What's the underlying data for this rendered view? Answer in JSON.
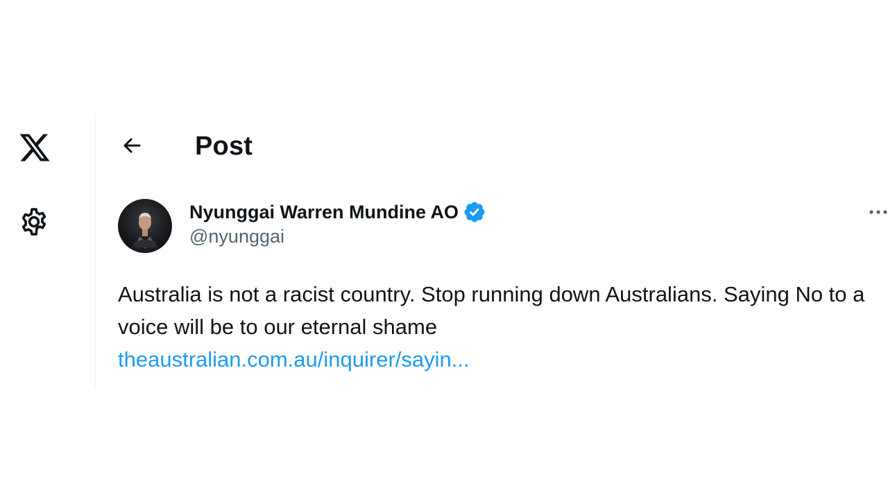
{
  "nav": {
    "logo_icon": "x-logo-icon",
    "settings_icon": "gear-icon"
  },
  "header": {
    "back_icon": "arrow-left-icon",
    "title": "Post"
  },
  "post": {
    "author": {
      "name": "Nyunggai Warren Mundine AO",
      "handle": "@nyunggai",
      "verified": true,
      "badge_icon": "verified-badge-icon",
      "badge_color": "#1d9bf0"
    },
    "more_icon": "more-options-icon",
    "text": "Australia is not a racist country. Stop running down Australians. Saying No to a voice will be to our eternal shame",
    "link_text": "theaustralian.com.au/inquirer/sayin...",
    "link_color": "#1d9bf0"
  },
  "colors": {
    "text_primary": "#0f1419",
    "text_secondary": "#536471",
    "accent": "#1d9bf0",
    "border": "#eff3f4"
  }
}
